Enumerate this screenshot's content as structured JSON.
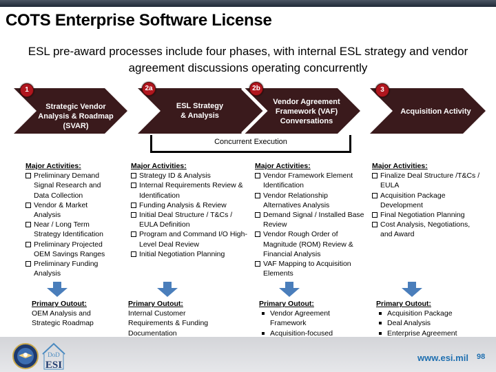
{
  "header": {
    "title": "COTS Enterprise Software License",
    "subtitle": "ESL pre-award processes include four phases, with internal ESL strategy and vendor agreement discussions operating concurrently"
  },
  "colors": {
    "chevron": "#3a1a1c",
    "badge": "#b0161e",
    "arrow": "#4a7ebb",
    "link": "#1f6fb0"
  },
  "phases": [
    {
      "badge": "1",
      "label_lines": [
        "Strategic Vendor",
        "Analysis & Roadmap",
        "(SVAR)"
      ]
    },
    {
      "badge": "2a",
      "label_lines": [
        "ESL Strategy",
        "& Analysis"
      ]
    },
    {
      "badge": "2b",
      "label_lines": [
        "Vendor Agreement",
        "Framework (VAF)",
        "Conversations"
      ]
    },
    {
      "badge": "3",
      "label_lines": [
        "Acquisition Activity"
      ]
    }
  ],
  "concurrent_label": "Concurrent Execution",
  "columns": [
    {
      "activities_header": "Major Activities:",
      "activities": [
        "Preliminary Demand Signal Research and Data Collection",
        "Vendor & Market Analysis",
        "Near / Long Term Strategy Identification",
        "Preliminary Projected OEM Savings Ranges",
        "Preliminary Funding Analysis"
      ],
      "output_header": "Primary Outout:",
      "output_text": "OEM Analysis and Strategic Roadmap"
    },
    {
      "activities_header": "Major Activities:",
      "activities": [
        "Strategy ID & Analysis",
        "Internal Requirements Review & Identification",
        "Funding Analysis & Review",
        "Initial Deal Structure / T&Cs / EULA Definition",
        "Program and Command I/O High-Level Deal Review",
        "Initial Negotiation Planning"
      ],
      "output_header": "Primary Outout:",
      "output_text": "Internal Customer Requirements & Funding Documentation"
    },
    {
      "activities_header": "Major Activities:",
      "activities": [
        "Vendor Framework Element Identification",
        "Vendor Relationship Alternatives Analysis",
        "Demand Signal / Installed Base Review",
        "Vendor Rough Order of Magnitude (ROM) Review & Financial Analysis",
        "VAF Mapping to Acquisition Elements"
      ],
      "output_header": "Primary Outout:",
      "output_bullets": [
        "Vendor Agreement Framework",
        "Acquisition-focused Business Case Analysis"
      ]
    },
    {
      "activities_header": "Major Activities:",
      "activities": [
        "Finalize Deal Structure /T&Cs / EULA",
        "Acquisition Package Development",
        "Final Negotiation Planning",
        "Cost Analysis, Negotiations, and Award"
      ],
      "output_header": "Primary Outout:",
      "output_bullets": [
        "Acquisition Package",
        "Deal Analysis",
        "Enterprise Agreement"
      ]
    }
  ],
  "footer": {
    "seal_icon": "dod-seal-icon",
    "logo_icon": "dod-esi-logo-icon",
    "logo_top": "DoD",
    "logo_bottom": "ESI",
    "url": "www.esi.mil",
    "page_number": "98"
  }
}
